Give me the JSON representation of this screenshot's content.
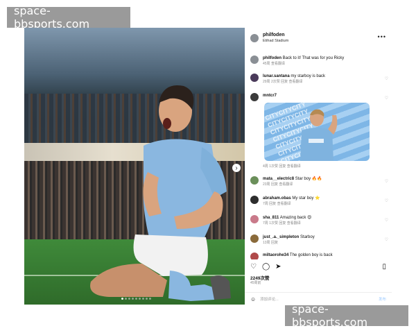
{
  "watermark": {
    "top": "space-bbsports.com",
    "bottom": "space-bbsports.com"
  },
  "post": {
    "username": "philfoden",
    "location": "Etihad Stadium",
    "carousel": {
      "count": 9,
      "active_index": 0
    }
  },
  "comments": [
    {
      "user": "philfoden",
      "text": "Back to it! That was for you Ricky",
      "time": "45周",
      "extra": "查看翻译"
    },
    {
      "user": "lunar.santana",
      "text": "my starboy is back",
      "time": "29周",
      "likes": "2次赞",
      "reply": "回复",
      "extra": "查看翻译"
    },
    {
      "user": "mntcr7",
      "text": "",
      "time": "4周",
      "likes": "1次赞",
      "reply": "回复",
      "extra": "查看翻译"
    },
    {
      "user": "mata__electric8",
      "text": "Star boy",
      "time": "23周",
      "likes": "",
      "reply": "回复",
      "extra": "查看翻译"
    },
    {
      "user": "abraham.obas",
      "text": "My star boy",
      "time": "7周",
      "reply": "回复",
      "extra": "查看翻译"
    },
    {
      "user": "sha_811",
      "text": "Amazing back",
      "time": "7周",
      "likes": "1次赞",
      "reply": "回复",
      "extra": "查看翻译"
    },
    {
      "user": "just_.a._simpleton",
      "text": "Starboy",
      "time": "13周",
      "reply": "回复"
    },
    {
      "user": "miltaorohe34",
      "text": "The golden boy is back",
      "time": ""
    }
  ],
  "sticker": {
    "pattern_text": "CITYCITYCITY"
  },
  "footer": {
    "likes": "2249次赞",
    "time": "45周前",
    "placeholder": "添加评论...",
    "post_label": "发布"
  },
  "colors": {
    "sticker": "#8cc2ee",
    "post_link": "#9ecbff"
  }
}
